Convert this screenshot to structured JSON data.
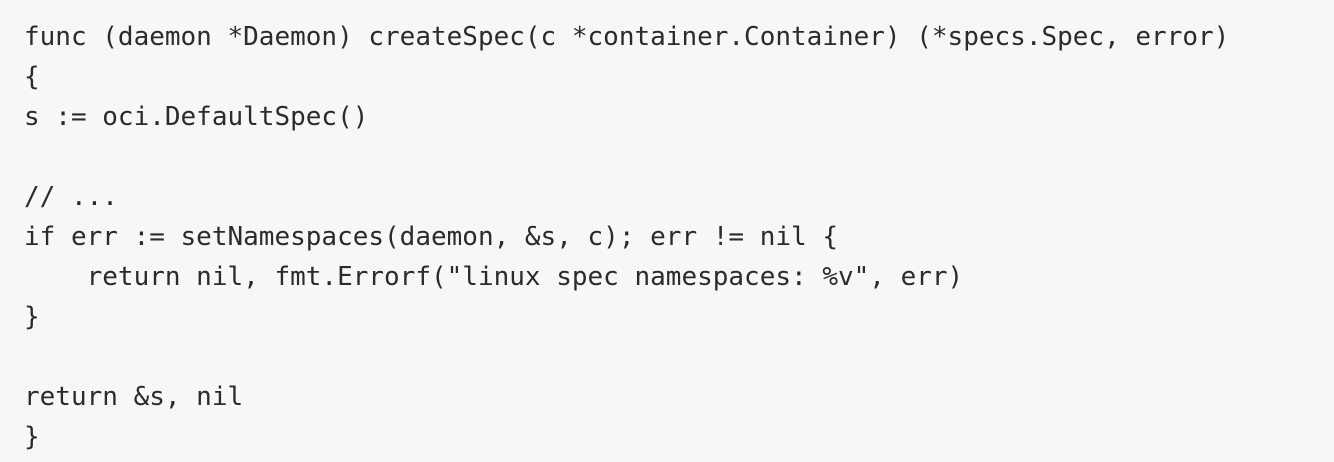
{
  "code": {
    "lines": [
      "func (daemon *Daemon) createSpec(c *container.Container) (*specs.Spec, error)",
      "{",
      "s := oci.DefaultSpec()",
      "",
      "// ...",
      "if err := setNamespaces(daemon, &s, c); err != nil {",
      "    return nil, fmt.Errorf(\"linux spec namespaces: %v\", err)",
      "}",
      "",
      "return &s, nil",
      "}"
    ]
  }
}
